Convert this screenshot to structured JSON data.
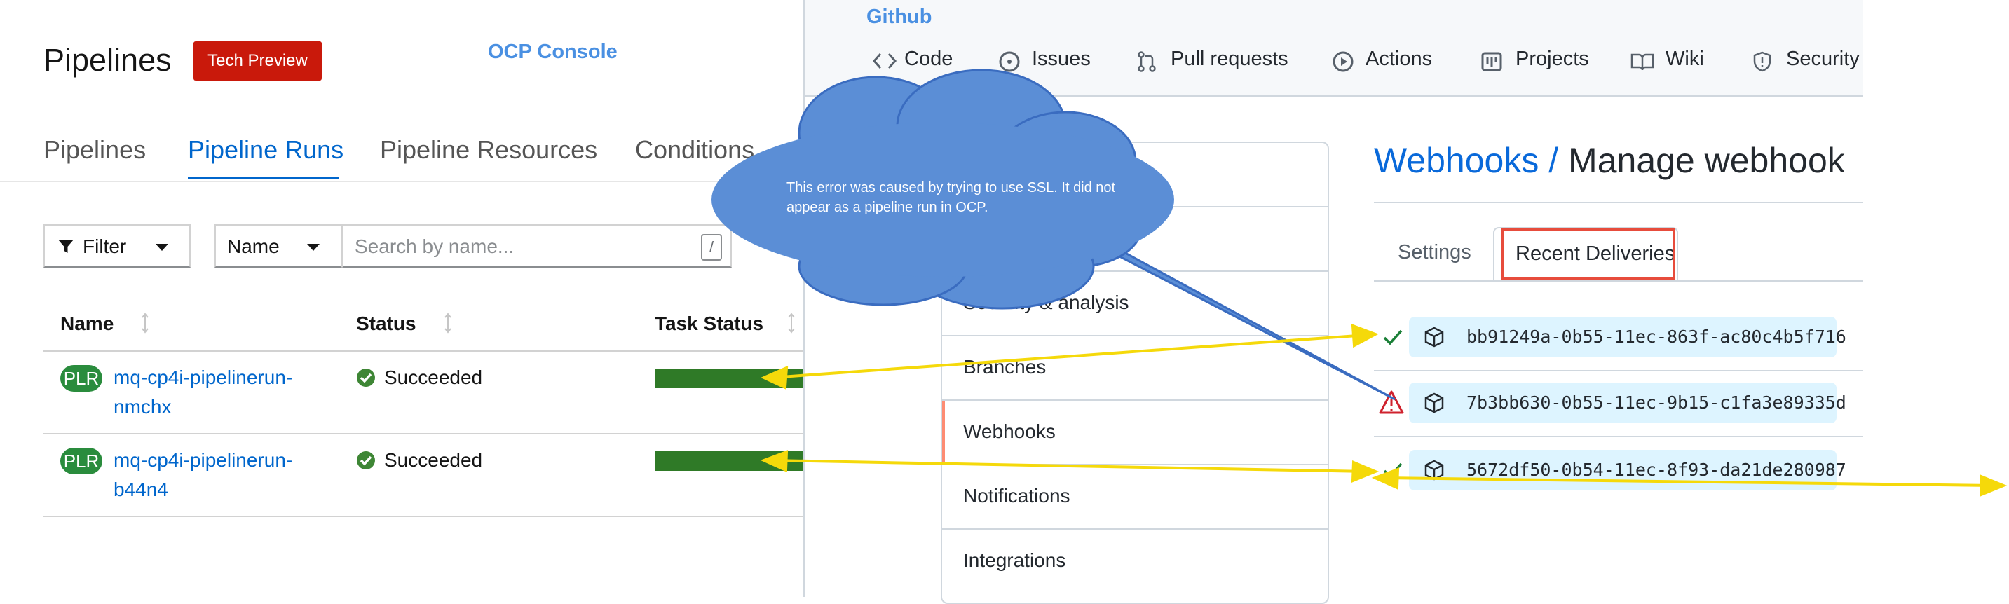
{
  "ocp": {
    "label": "OCP Console",
    "page_title": "Pipelines",
    "badge": "Tech Preview",
    "tabs": [
      "Pipelines",
      "Pipeline Runs",
      "Pipeline Resources",
      "Conditions"
    ],
    "active_tab": "Pipeline Runs",
    "toolbar": {
      "filter_label": "Filter",
      "name_select": "Name",
      "search_placeholder": "Search by name...",
      "search_shortcut": "/"
    },
    "table": {
      "columns": [
        "Name",
        "Status",
        "Task Status"
      ],
      "rows": [
        {
          "badge": "PLR",
          "name_line1": "mq-cp4i-pipelinerun-",
          "name_line2": "nmchx",
          "status": "Succeeded",
          "task_progress": 1.0
        },
        {
          "badge": "PLR",
          "name_line1": "mq-cp4i-pipelinerun-",
          "name_line2": "b44n4",
          "status": "Succeeded",
          "task_progress": 1.0
        }
      ]
    }
  },
  "github": {
    "label": "Github",
    "nav": [
      {
        "label": "Code",
        "icon": "code-icon"
      },
      {
        "label": "Issues",
        "icon": "issue-icon"
      },
      {
        "label": "Pull requests",
        "icon": "pull-request-icon"
      },
      {
        "label": "Actions",
        "icon": "play-icon"
      },
      {
        "label": "Projects",
        "icon": "project-icon"
      },
      {
        "label": "Wiki",
        "icon": "book-icon"
      },
      {
        "label": "Security",
        "icon": "shield-icon"
      }
    ],
    "settings_menu": [
      "Security & analysis",
      "Branches",
      "Webhooks",
      "Notifications",
      "Integrations"
    ],
    "selected_menu": "Webhooks",
    "breadcrumb": "Webhooks",
    "breadcrumb_sep": "/",
    "page_title": "Manage webhook",
    "tabs": [
      "Settings",
      "Recent Deliveries"
    ],
    "active_tab": "Recent Deliveries",
    "deliveries": [
      {
        "guid": "bb91249a-0b55-11ec-863f-ac80c4b5f716",
        "status": "success"
      },
      {
        "guid": "7b3bb630-0b55-11ec-9b15-c1fa3e89335d",
        "status": "error"
      },
      {
        "guid": "5672df50-0b54-11ec-8f93-da21de280987",
        "status": "success"
      }
    ]
  },
  "annotation": {
    "callout_text": "This error was caused by trying to use SSL. It did not appear as a pipeline run in OCP.",
    "colors": {
      "cloud": "#5b8ed6",
      "arrows": "#f5d90a"
    }
  }
}
